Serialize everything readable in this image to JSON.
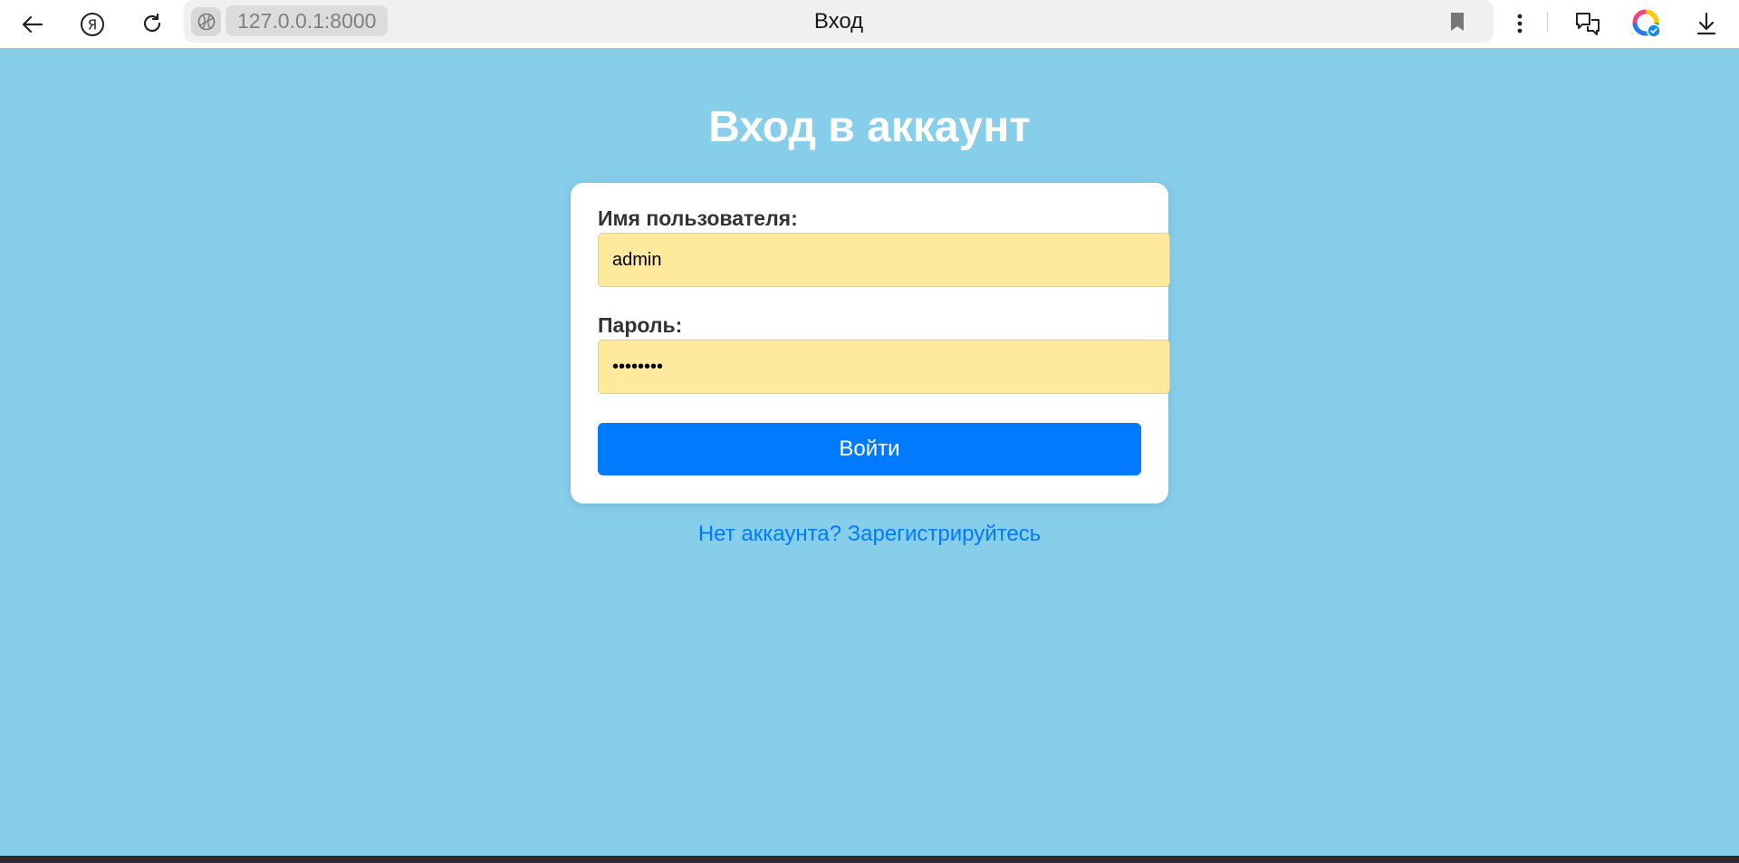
{
  "browser": {
    "url": "127.0.0.1:8000",
    "tab_title": "Вход"
  },
  "page": {
    "title": "Вход в аккаунт",
    "form": {
      "username_label": "Имя пользователя:",
      "username_value": "admin",
      "password_label": "Пароль:",
      "password_value": "password",
      "submit_label": "Войти"
    },
    "register_link": "Нет аккаунта? Зарегистрируйтесь"
  },
  "icons": {
    "back": "back-arrow-icon",
    "yandex": "yandex-logo-icon",
    "reload": "reload-icon",
    "site": "site-info-icon",
    "bookmark": "bookmark-icon",
    "menu": "more-vertical-icon",
    "translate": "translate-icon",
    "alice": "alice-icon",
    "download": "download-icon"
  },
  "colors": {
    "background": "#87ceeb",
    "card": "#ffffff",
    "input_bg": "#fee99c",
    "button": "#007bff",
    "link": "#007bff"
  }
}
